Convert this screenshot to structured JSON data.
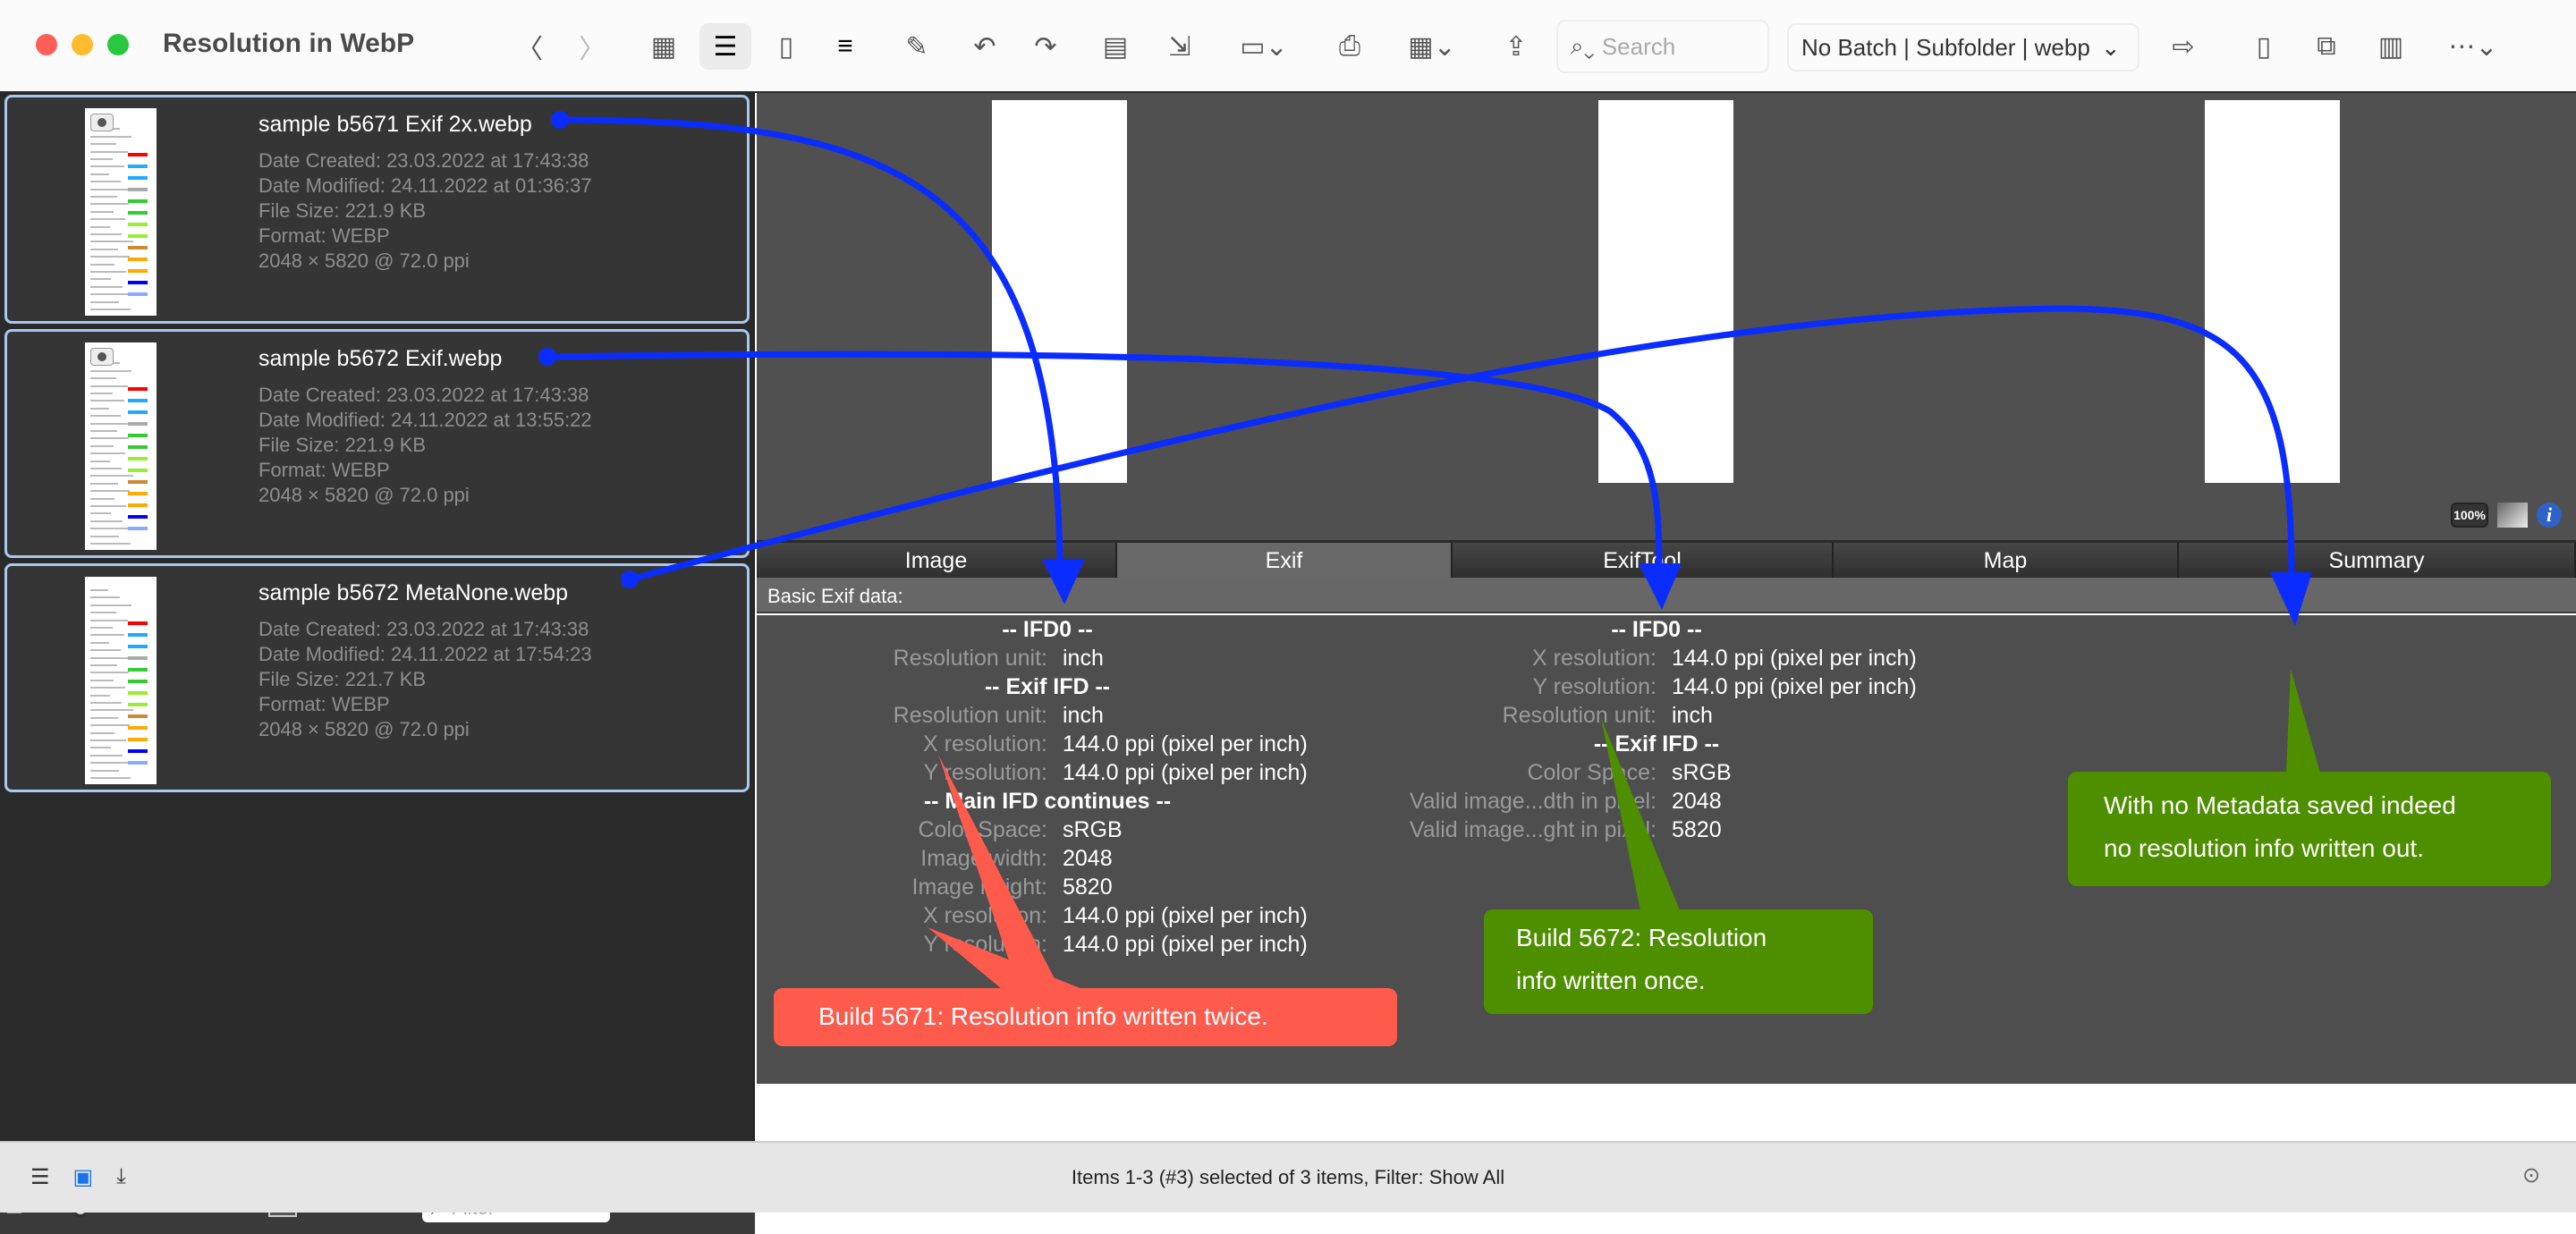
{
  "window": {
    "title": "Resolution in WebP"
  },
  "toolbar": {
    "search_placeholder": "Search",
    "batch_select": "No Batch | Subfolder | webp"
  },
  "files": [
    {
      "name": "sample b5671 Exif 2x.webp",
      "date_created": "Date Created: 23.03.2022 at 17:43:38",
      "date_modified": "Date Modified: 24.11.2022 at 01:36:37",
      "file_size": "File Size: 221.9 KB",
      "format": "Format: WEBP",
      "dimensions": "2048 × 5820 @ 72.0 ppi"
    },
    {
      "name": "sample b5672 Exif.webp",
      "date_created": "Date Created: 23.03.2022 at 17:43:38",
      "date_modified": "Date Modified: 24.11.2022 at 13:55:22",
      "file_size": "File Size: 221.9 KB",
      "format": "Format: WEBP",
      "dimensions": "2048 × 5820 @ 72.0 ppi"
    },
    {
      "name": "sample b5672 MetaNone.webp",
      "date_created": "Date Created: 23.03.2022 at 17:43:38",
      "date_modified": "Date Modified: 24.11.2022 at 17:54:23",
      "file_size": "File Size: 221.7 KB",
      "format": "Format: WEBP",
      "dimensions": "2048 × 5820 @ 72.0 ppi"
    }
  ],
  "left_bottom": {
    "filter_placeholder": "Filter"
  },
  "preview": {
    "zoom_label": "100%"
  },
  "tabs": [
    "Image",
    "Exif",
    "ExifTool",
    "Map",
    "Summary"
  ],
  "active_tab": "Exif",
  "info_header": "Basic Exif data:",
  "exif_col1": [
    {
      "h": "-- IFD0 --"
    },
    {
      "l": "Resolution unit:",
      "v": "inch"
    },
    {
      "h": "-- Exif IFD --"
    },
    {
      "l": "Resolution unit:",
      "v": "inch"
    },
    {
      "l": "X resolution:",
      "v": "144.0 ppi (pixel per inch)"
    },
    {
      "l": "Y resolution:",
      "v": "144.0 ppi (pixel per inch)"
    },
    {
      "h": "-- Main IFD continues --"
    },
    {
      "l": "Color Space:",
      "v": "sRGB"
    },
    {
      "l": "Image width:",
      "v": "2048"
    },
    {
      "l": "Image height:",
      "v": "5820"
    },
    {
      "l": "X resolution:",
      "v": "144.0 ppi (pixel per inch)"
    },
    {
      "l": "Y resolution:",
      "v": "144.0 ppi (pixel per inch)"
    }
  ],
  "exif_col2": [
    {
      "h": "-- IFD0 --"
    },
    {
      "l": "X resolution:",
      "v": "144.0 ppi (pixel per inch)"
    },
    {
      "l": "Y resolution:",
      "v": "144.0 ppi (pixel per inch)"
    },
    {
      "l": "Resolution unit:",
      "v": "inch"
    },
    {
      "h": "-- Exif IFD --"
    },
    {
      "l": "Color Space:",
      "v": "sRGB"
    },
    {
      "l": "Valid image...dth in pixel:",
      "v": "2048"
    },
    {
      "l": "Valid image...ght in pixel:",
      "v": "5820"
    }
  ],
  "callouts": {
    "red": "Build 5671: Resolution info written twice.",
    "green1_line1": "Build 5672: Resolution",
    "green1_line2": "info written once.",
    "green2_line1": "With no Metadata saved indeed",
    "green2_line2": "no resolution info written out."
  },
  "colors": {
    "arrow": "#0a2cff",
    "red_callout": "#ff5b4d",
    "green_callout": "#4e8f00",
    "selection_border": "#a8c8f0"
  },
  "status": {
    "text": "Items 1-3 (#3) selected of 3 items, Filter: Show All"
  }
}
